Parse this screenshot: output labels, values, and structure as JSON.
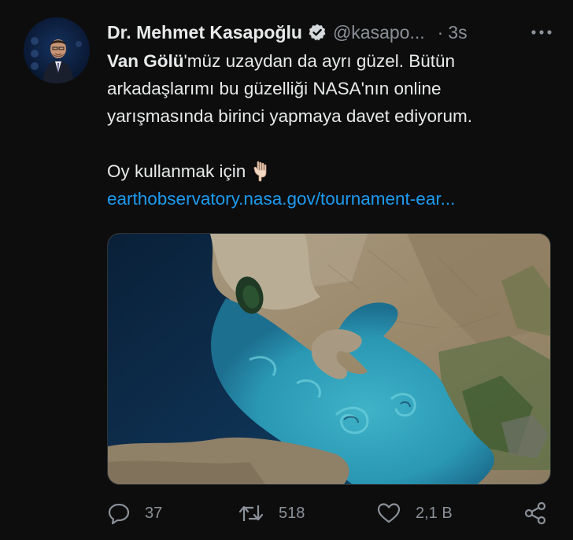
{
  "author": {
    "display_name": "Dr. Mehmet Kasapoğlu",
    "handle": "@kasapo...",
    "separator": "·",
    "time": "3s",
    "verified": true
  },
  "tweet": {
    "bold_prefix": "Van Gölü",
    "line1_rest": "'müz uzaydan da ayrı güzel. Bütün",
    "line2": "arkadaşlarımı bu güzelliği NASA'nın online",
    "line3": "yarışmasında birinci yapmaya davet ediyorum.",
    "line4": "Oy kullanmak için",
    "emoji": "pointing-down-hand-icon",
    "link": "earthobservatory.nasa.gov/tournament-ear..."
  },
  "media": {
    "kind": "satellite-image",
    "subject": "Lake Van from space"
  },
  "actions": {
    "reply_count": "37",
    "retweet_count": "518",
    "like_count": "2,1 B"
  },
  "colors": {
    "background": "#0d0d0d",
    "text": "#e7e9ea",
    "muted": "#8b9199",
    "link": "#1d9bf0",
    "verified": "#d6d9db"
  }
}
